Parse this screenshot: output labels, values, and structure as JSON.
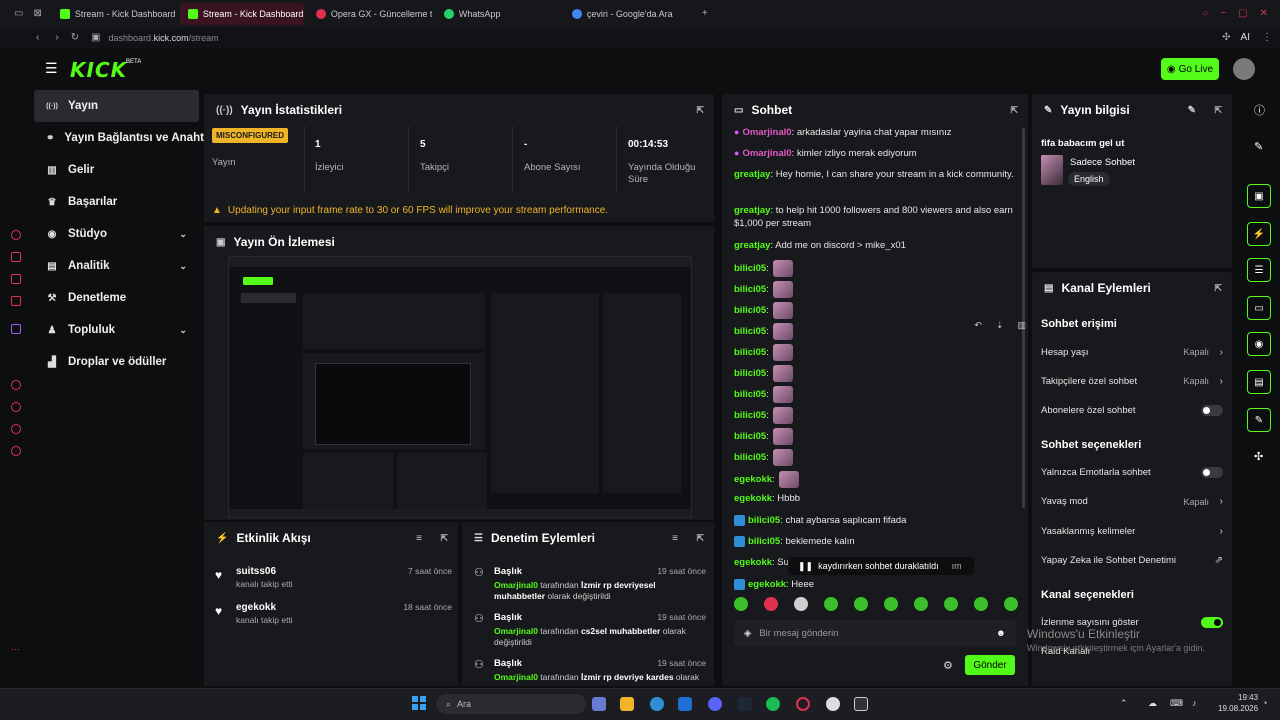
{
  "browser": {
    "tabs": [
      {
        "label": "Stream - Kick Dashboard",
        "active": false
      },
      {
        "label": "Stream - Kick Dashboard",
        "active": true
      },
      {
        "label": "Opera GX - Güncelleme ta",
        "active": false
      },
      {
        "label": "WhatsApp",
        "active": false
      },
      {
        "label": "çeviri - Google'da Ara",
        "active": false
      }
    ],
    "url_host": "dashboard.",
    "url_domain": "kick.com",
    "url_path": "/stream"
  },
  "header": {
    "logo": "KICK",
    "beta": "BETA",
    "go_live": "Go Live"
  },
  "nav": [
    {
      "label": "Yayın",
      "icon": "broadcast-icon",
      "chevron": false
    },
    {
      "label": "Yayın Bağlantısı ve Anahtarı",
      "icon": "link-icon",
      "chevron": false
    },
    {
      "label": "Gelir",
      "icon": "revenue-icon",
      "chevron": false
    },
    {
      "label": "Başarılar",
      "icon": "trophy-icon",
      "chevron": false
    },
    {
      "label": "Stüdyo",
      "icon": "studio-icon",
      "chevron": true
    },
    {
      "label": "Analitik",
      "icon": "analytics-icon",
      "chevron": true
    },
    {
      "label": "Denetleme",
      "icon": "gavel-icon",
      "chevron": false
    },
    {
      "label": "Topluluk",
      "icon": "community-icon",
      "chevron": true
    },
    {
      "label": "Droplar ve ödüller",
      "icon": "gift-icon",
      "chevron": false
    }
  ],
  "stats": {
    "title": "Yayın İstatistikleri",
    "status_badge": "MISCONFIGURED",
    "status_label": "Yayın",
    "viewers_value": "1",
    "viewers_label": "İzleyici",
    "followers_value": "5",
    "followers_label": "Takipçi",
    "subs_value": "-",
    "subs_label": "Abone Sayısı",
    "time_value": "00:14:53",
    "time_label": "Yayında Olduğu Süre",
    "warning": "Updating your input frame rate to 30 or 60 FPS will improve your stream performance."
  },
  "preview": {
    "title": "Yayın Ön İzlemesi"
  },
  "activity": {
    "title": "Etkinlik Akışı",
    "items": [
      {
        "name": "suitss06",
        "sub": "kanalı takip etti",
        "time": "7 saat önce"
      },
      {
        "name": "egekokk",
        "sub": "kanalı takip etti",
        "time": "18 saat önce"
      }
    ]
  },
  "moderation": {
    "title": "Denetim Eylemleri",
    "items": [
      {
        "title": "Başlık",
        "user": "Omarjinal0",
        "mid": " tarafından ",
        "target": "İzmir rp devriyesel muhabbetler",
        "tail": " olarak değiştirildi",
        "time": "19 saat önce"
      },
      {
        "title": "Başlık",
        "user": "Omarjinal0",
        "mid": " tarafından ",
        "target": "cs2sel muhabbetler",
        "tail": " olarak değiştirildi",
        "time": "19 saat önce"
      },
      {
        "title": "Başlık",
        "user": "Omarjinal0",
        "mid": " tarafından ",
        "target": "İzmir rp devriye kardes",
        "tail": " olarak",
        "time": "19 saat önce"
      }
    ]
  },
  "chat": {
    "title": "Sohbet",
    "messages": [
      {
        "user": "Omarjinal0",
        "text": ": arkadaslar yayina chat yapar mısınız",
        "kind": "mic"
      },
      {
        "user": "Omarjinal0",
        "text": ": kimler izliyo merak ediyorum",
        "kind": "mic"
      },
      {
        "user": "greatjay",
        "text": ": Hey homie, I can share your stream in a kick community.",
        "kind": "plain"
      },
      {
        "user": "greatjay",
        "text": ": to help hit 1000 followers and 800 viewers and also earn $1,000 per stream",
        "kind": "plain"
      },
      {
        "user": "greatjay",
        "text": ": Add me on discord > mike_x01",
        "kind": "plain"
      },
      {
        "user": "bilici05",
        "text": ":",
        "kind": "emote"
      },
      {
        "user": "bilici05",
        "text": ":",
        "kind": "emote"
      },
      {
        "user": "bilici05",
        "text": ":",
        "kind": "emote"
      },
      {
        "user": "bilici05",
        "text": ":",
        "kind": "emote"
      },
      {
        "user": "bilici05",
        "text": ":",
        "kind": "emote"
      },
      {
        "user": "bilici05",
        "text": ":",
        "kind": "emote"
      },
      {
        "user": "bilici05",
        "text": ":",
        "kind": "emote"
      },
      {
        "user": "bilici05",
        "text": ":",
        "kind": "emote"
      },
      {
        "user": "bilici05",
        "text": ":",
        "kind": "emote"
      },
      {
        "user": "bilici05",
        "text": ":",
        "kind": "emote"
      },
      {
        "user": "egekokk",
        "text": ":",
        "kind": "emote"
      },
      {
        "user": "egekokk",
        "text": ": Hbbb",
        "kind": "plain"
      },
      {
        "user": "bilici05",
        "text": ": chat aybarsa saplıcam fifada",
        "kind": "badge"
      },
      {
        "user": "bilici05",
        "text": ": beklemede kalın",
        "kind": "badge"
      },
      {
        "user": "egekokk",
        "text": ": Su",
        "kind": "plain"
      },
      {
        "user": "egekokk",
        "text": ": Heee",
        "kind": "badge"
      }
    ],
    "paused_text": "kaydırırken sohbet duraklatıldı",
    "paused_tail": "ım",
    "input_placeholder": "Bir mesaj gönderin",
    "send_label": "Gönder"
  },
  "stream_info": {
    "title": "Yayın bilgisi",
    "stream_title": "fifa babacım gel ut",
    "category": "Sadece Sohbet",
    "language": "English"
  },
  "channel_actions": {
    "title": "Kanal Eylemleri",
    "sec_access": "Sohbet erişimi",
    "rows_access": [
      {
        "label": "Hesap yaşı",
        "value": "Kapalı",
        "type": "chev"
      },
      {
        "label": "Takipçilere özel sohbet",
        "value": "Kapalı",
        "type": "chev"
      },
      {
        "label": "Abonelere özel sohbet",
        "value": "",
        "type": "toggle"
      }
    ],
    "sec_chat": "Sohbet seçenekleri",
    "rows_chat": [
      {
        "label": "Yalnızca Emotlarla sohbet",
        "value": "",
        "type": "toggle"
      },
      {
        "label": "Yavaş mod",
        "value": "Kapalı",
        "type": "chev"
      },
      {
        "label": "Yasaklanmış kelimeler",
        "value": "",
        "type": "chev"
      },
      {
        "label": "Yapay Zeka ile Sohbet Denetimi",
        "value": "",
        "type": "ext"
      }
    ],
    "sec_channel": "Kanal seçenekleri",
    "rows_channel": [
      {
        "label": "İzlenme sayısını göster",
        "value": "",
        "type": "toggle-on"
      },
      {
        "label": "Raid Kanalı",
        "value": "",
        "type": "none"
      }
    ]
  },
  "windows": {
    "activation_title": "Windows'u Etkinleştir",
    "activation_sub": "Windows'u etkinleştirmek için Ayarlar'a gidin.",
    "search_placeholder": "Ara",
    "time": "19:43",
    "date": "19.08.2026"
  },
  "colors": {
    "accent": "#53fc18",
    "warning": "#f0b429",
    "chat_user_pink": "#e357c7",
    "tab_active": "#3a1520"
  }
}
